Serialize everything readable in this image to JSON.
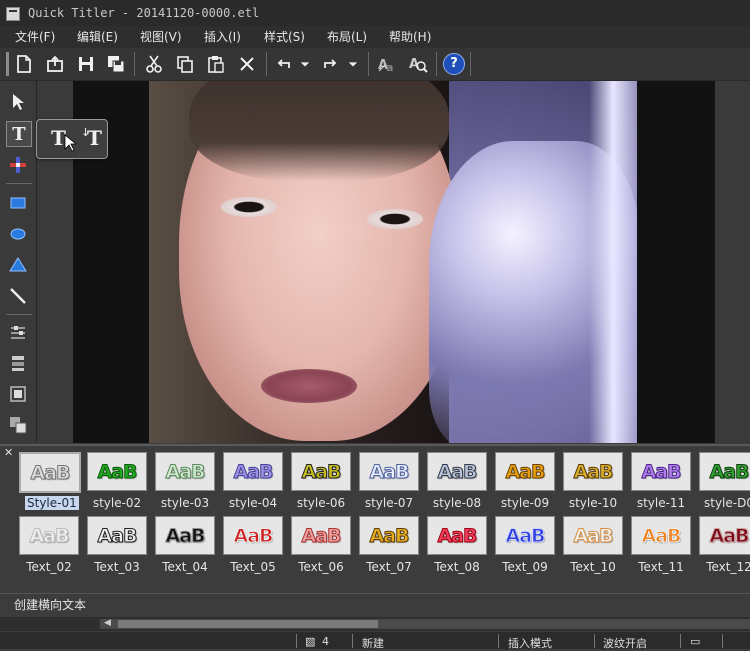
{
  "window": {
    "title": "Quick Titler - 20141120-0000.etl"
  },
  "menu": [
    {
      "label": "文件(F)"
    },
    {
      "label": "编辑(E)"
    },
    {
      "label": "视图(V)"
    },
    {
      "label": "插入(I)"
    },
    {
      "label": "样式(S)"
    },
    {
      "label": "布局(L)"
    },
    {
      "label": "帮助(H)"
    }
  ],
  "toolbar": {
    "icons": [
      "new-file-icon",
      "open-file-icon",
      "save-icon",
      "save-all-icon",
      "cut-icon",
      "copy-icon",
      "paste-icon",
      "delete-icon",
      "undo-icon",
      "undo-dropdown-icon",
      "redo-icon",
      "redo-dropdown-icon",
      "text-style-icon",
      "find-text-icon",
      "help-icon"
    ],
    "help_glyph": "?"
  },
  "left_tools": {
    "text_tool_glyph": "T",
    "tooltip": {
      "horizontal_glyph": "T",
      "vertical_glyph": "T"
    }
  },
  "styles_row1": [
    {
      "name": "Style-01",
      "sample": "AaB",
      "fill": "#dcdcdc",
      "stroke": "#777777",
      "selected": true
    },
    {
      "name": "style-02",
      "sample": "AaB",
      "fill": "#22aa22",
      "stroke": "#0a5a0a"
    },
    {
      "name": "style-03",
      "sample": "AaB",
      "fill": "#cfe8cf",
      "stroke": "#5a8a5a"
    },
    {
      "name": "style-04",
      "sample": "AaB",
      "fill": "#9a90e0",
      "stroke": "#4a40a0"
    },
    {
      "name": "style-06",
      "sample": "AaB",
      "fill": "#c8c020",
      "stroke": "#202020"
    },
    {
      "name": "style-07",
      "sample": "AaB",
      "fill": "#e8f0ff",
      "stroke": "#5060a0"
    },
    {
      "name": "style-08",
      "sample": "AaB",
      "fill": "#b8c4d8",
      "stroke": "#303848"
    },
    {
      "name": "style-09",
      "sample": "AaB",
      "fill": "#e8a010",
      "stroke": "#6a4000"
    },
    {
      "name": "style-10",
      "sample": "AaB",
      "fill": "#d8b030",
      "stroke": "#5a3a00"
    },
    {
      "name": "style-11",
      "sample": "AaB",
      "fill": "#b080e8",
      "stroke": "#4a2090"
    },
    {
      "name": "style-D0",
      "sample": "AaB",
      "fill": "#30a030",
      "stroke": "#104010"
    }
  ],
  "styles_row2": [
    {
      "name": "Text_02",
      "sample": "AaB",
      "fill": "#eeeeee",
      "stroke": "#bbbbbb"
    },
    {
      "name": "Text_03",
      "sample": "AaB",
      "fill": "#f0f0f0",
      "stroke": "#202020"
    },
    {
      "name": "Text_04",
      "sample": "AaB",
      "fill": "#101010",
      "stroke": "#909090"
    },
    {
      "name": "Text_05",
      "sample": "AaB",
      "fill": "#d02020",
      "stroke": "#f0f0f0"
    },
    {
      "name": "Text_06",
      "sample": "AaB",
      "fill": "#e8a0a0",
      "stroke": "#b03030"
    },
    {
      "name": "Text_07",
      "sample": "AaB",
      "fill": "#e8b020",
      "stroke": "#5a3a00"
    },
    {
      "name": "Text_08",
      "sample": "AaB",
      "fill": "#f04060",
      "stroke": "#a00010"
    },
    {
      "name": "Text_09",
      "sample": "AaB",
      "fill": "#3040e0",
      "stroke": "#d0d8ff"
    },
    {
      "name": "Text_10",
      "sample": "AaB",
      "fill": "#f0f0f0",
      "stroke": "#d89040"
    },
    {
      "name": "Text_11",
      "sample": "AaB",
      "fill": "#f08020",
      "stroke": "#f0f0f0"
    },
    {
      "name": "Text_12",
      "sample": "AaB",
      "fill": "#7a0a18",
      "stroke": "#d0a0a0"
    }
  ],
  "status": {
    "hint": "创建横向文本"
  },
  "bottombar": {
    "count": "4",
    "mode_new": "新建",
    "insert_mode": "插入模式",
    "ripple": "波纹开启"
  }
}
